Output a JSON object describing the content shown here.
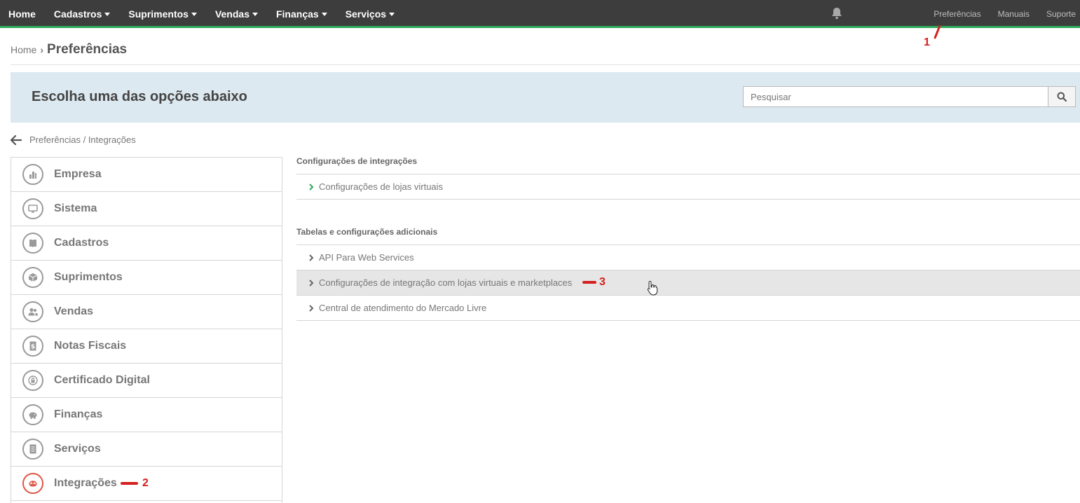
{
  "nav": {
    "items": [
      {
        "label": "Home",
        "dropdown": false
      },
      {
        "label": "Cadastros",
        "dropdown": true
      },
      {
        "label": "Suprimentos",
        "dropdown": true
      },
      {
        "label": "Vendas",
        "dropdown": true
      },
      {
        "label": "Finanças",
        "dropdown": true
      },
      {
        "label": "Serviços",
        "dropdown": true
      }
    ],
    "right": [
      "Preferências",
      "Manuais",
      "Suporte"
    ],
    "bell_icon": "bell-icon",
    "accent_color": "#2eaa5a"
  },
  "breadcrumb": {
    "home": "Home",
    "current": "Preferências"
  },
  "banner": {
    "title": "Escolha uma das opções abaixo",
    "search_placeholder": "Pesquisar"
  },
  "back": {
    "label": "Preferências / Integrações"
  },
  "sidebar": {
    "items": [
      {
        "label": "Empresa",
        "icon": "building-icon"
      },
      {
        "label": "Sistema",
        "icon": "monitor-icon"
      },
      {
        "label": "Cadastros",
        "icon": "book-icon"
      },
      {
        "label": "Suprimentos",
        "icon": "box-icon"
      },
      {
        "label": "Vendas",
        "icon": "users-icon"
      },
      {
        "label": "Notas Fiscais",
        "icon": "receipt-icon"
      },
      {
        "label": "Certificado Digital",
        "icon": "lock-icon"
      },
      {
        "label": "Finanças",
        "icon": "piggy-bank-icon"
      },
      {
        "label": "Serviços",
        "icon": "document-icon"
      },
      {
        "label": "Integrações",
        "icon": "integration-icon",
        "active": true
      }
    ]
  },
  "content": {
    "sections": [
      {
        "title": "Configurações de integrações",
        "items": [
          "Configurações de lojas virtuais"
        ]
      },
      {
        "title": "Tabelas e configurações adicionais",
        "items": [
          "API Para Web Services",
          "Configurações de integração com lojas virtuais e marketplaces",
          "Central de atendimento do Mercado Livre"
        ]
      }
    ]
  },
  "annotations": {
    "one": "1",
    "two": "2",
    "three": "3"
  }
}
